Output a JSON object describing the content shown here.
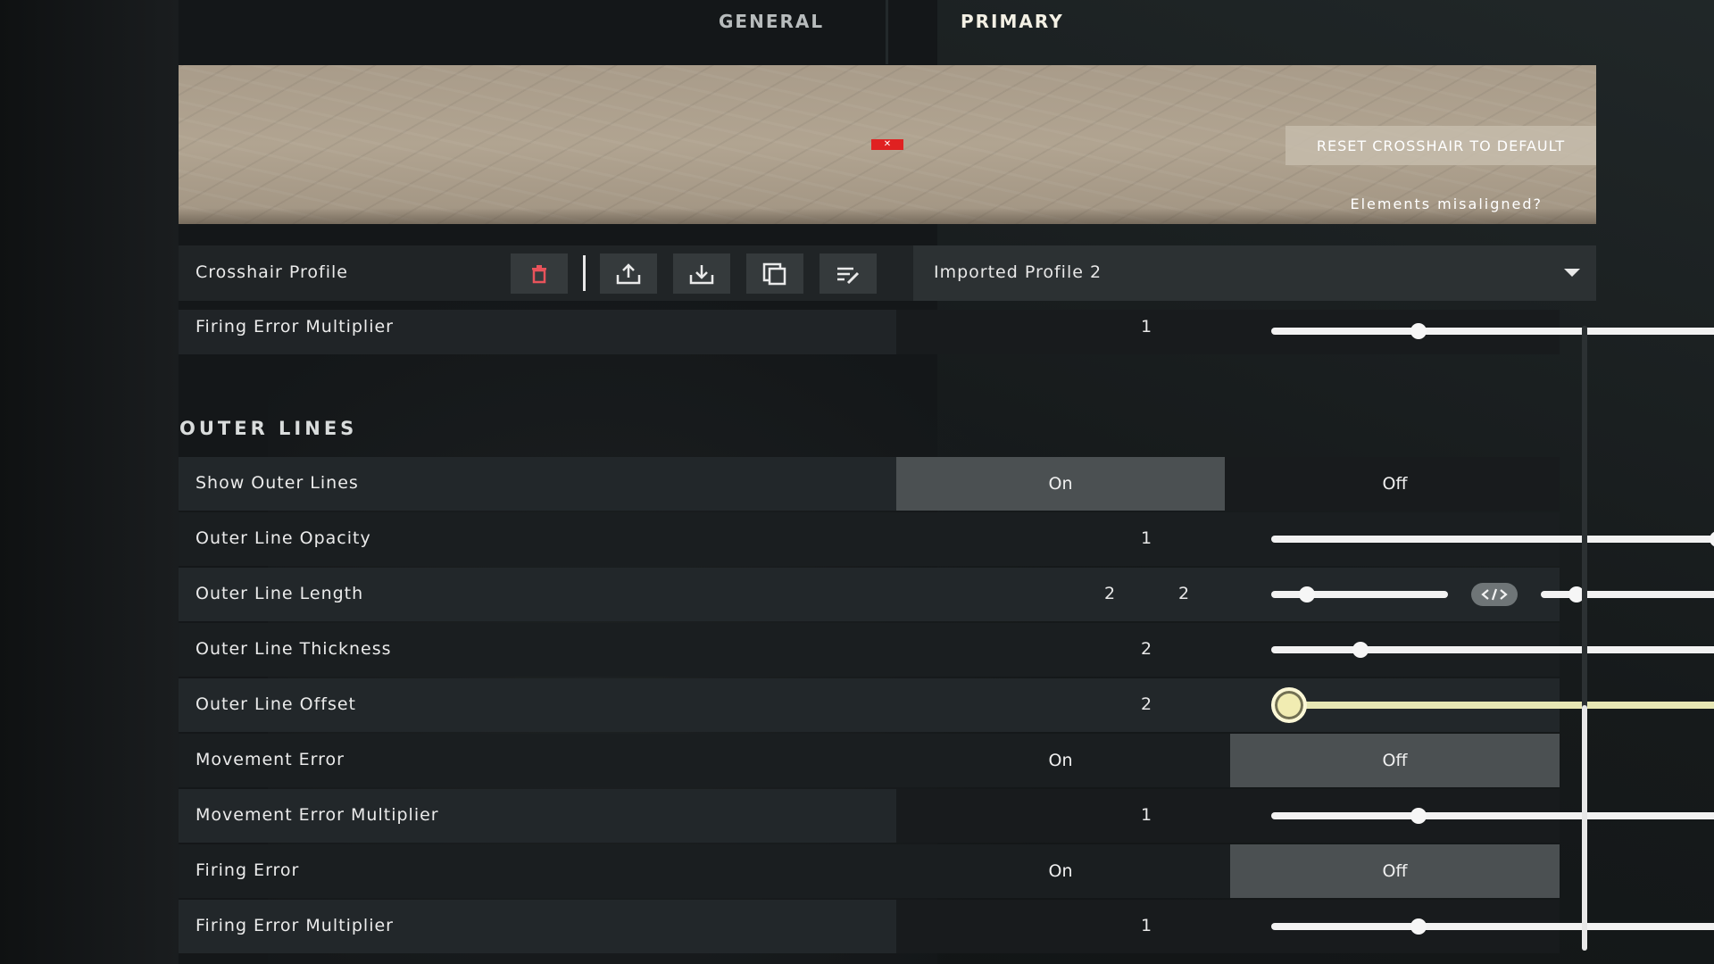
{
  "tabs": {
    "general": "GENERAL",
    "primary": "PRIMARY"
  },
  "preview": {
    "crosshair_icon": "crosshair-marker",
    "crosshair_color": "#e02121",
    "reset_label": "RESET CROSSHAIR TO DEFAULT",
    "misaligned_label": "Elements misaligned?"
  },
  "profile": {
    "label": "Crosshair Profile",
    "buttons": [
      "trash-icon",
      "share-icon",
      "import-icon",
      "copy-icon",
      "edit-icon"
    ],
    "selected": "Imported Profile 2"
  },
  "top_row": {
    "label": "Firing Error Multiplier",
    "value": "1",
    "fraction": 0.33
  },
  "section_title": "OUTER LINES",
  "rows": {
    "show_outer_lines": {
      "label": "Show Outer Lines",
      "on": "On",
      "off": "Off",
      "selected": "On"
    },
    "outer_line_opacity": {
      "label": "Outer Line Opacity",
      "value": "1",
      "fraction": 1.0
    },
    "outer_line_length": {
      "label": "Outer Line Length",
      "value_left": "2",
      "value_right": "2",
      "fraction_left": 0.2,
      "fraction_right": 0.2,
      "link_icon": "link-code-icon"
    },
    "outer_line_thickness": {
      "label": "Outer Line Thickness",
      "value": "2",
      "fraction": 0.2
    },
    "outer_line_offset": {
      "label": "Outer Line Offset",
      "value": "2",
      "fraction": 0.04
    },
    "movement_error": {
      "label": "Movement Error",
      "on": "On",
      "off": "Off",
      "selected": "Off"
    },
    "movement_error_multiplier": {
      "label": "Movement Error Multiplier",
      "value": "1",
      "fraction": 0.33
    },
    "firing_error": {
      "label": "Firing Error",
      "on": "On",
      "off": "Off",
      "selected": "Off"
    },
    "firing_error_multiplier": {
      "label": "Firing Error Multiplier",
      "value": "1",
      "fraction": 0.33
    }
  },
  "colors": {
    "accent_slider": "#e6e6b4",
    "toggle_selected": "#4b5052",
    "background": "#141719"
  }
}
